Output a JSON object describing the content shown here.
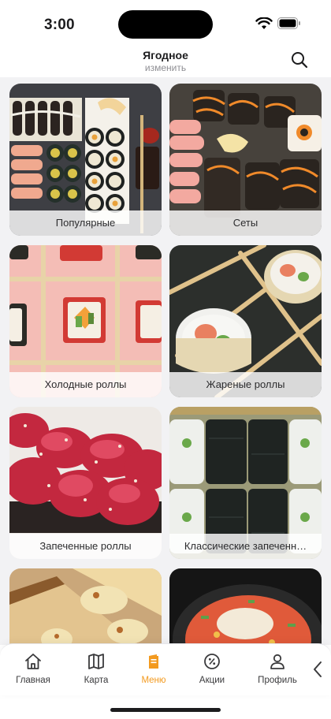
{
  "status": {
    "time": "3:00"
  },
  "header": {
    "title": "Ягодное",
    "subtitle": "изменить",
    "search_icon": "search-icon"
  },
  "categories": [
    {
      "label": "Популярные",
      "icon": "sushi-platter-photo"
    },
    {
      "label": "Сеты",
      "icon": "sushi-set-photo"
    },
    {
      "label": "Холодные роллы",
      "icon": "cold-rolls-photo"
    },
    {
      "label": "Жареные роллы",
      "icon": "fried-rolls-photo"
    },
    {
      "label": "Запеченные роллы",
      "icon": "baked-rolls-photo"
    },
    {
      "label": "Классические запеченн…",
      "icon": "classic-rolls-photo"
    },
    {
      "label": "",
      "icon": "pizza-photo"
    },
    {
      "label": "",
      "icon": "poke-photo"
    }
  ],
  "tabbar": {
    "items": [
      {
        "label": "Главная",
        "icon": "home-icon"
      },
      {
        "label": "Карта",
        "icon": "map-icon"
      },
      {
        "label": "Меню",
        "icon": "menu-icon",
        "active": true
      },
      {
        "label": "Акции",
        "icon": "percent-badge-icon"
      },
      {
        "label": "Профиль",
        "icon": "profile-icon"
      }
    ],
    "accent": "#f39a1f"
  }
}
